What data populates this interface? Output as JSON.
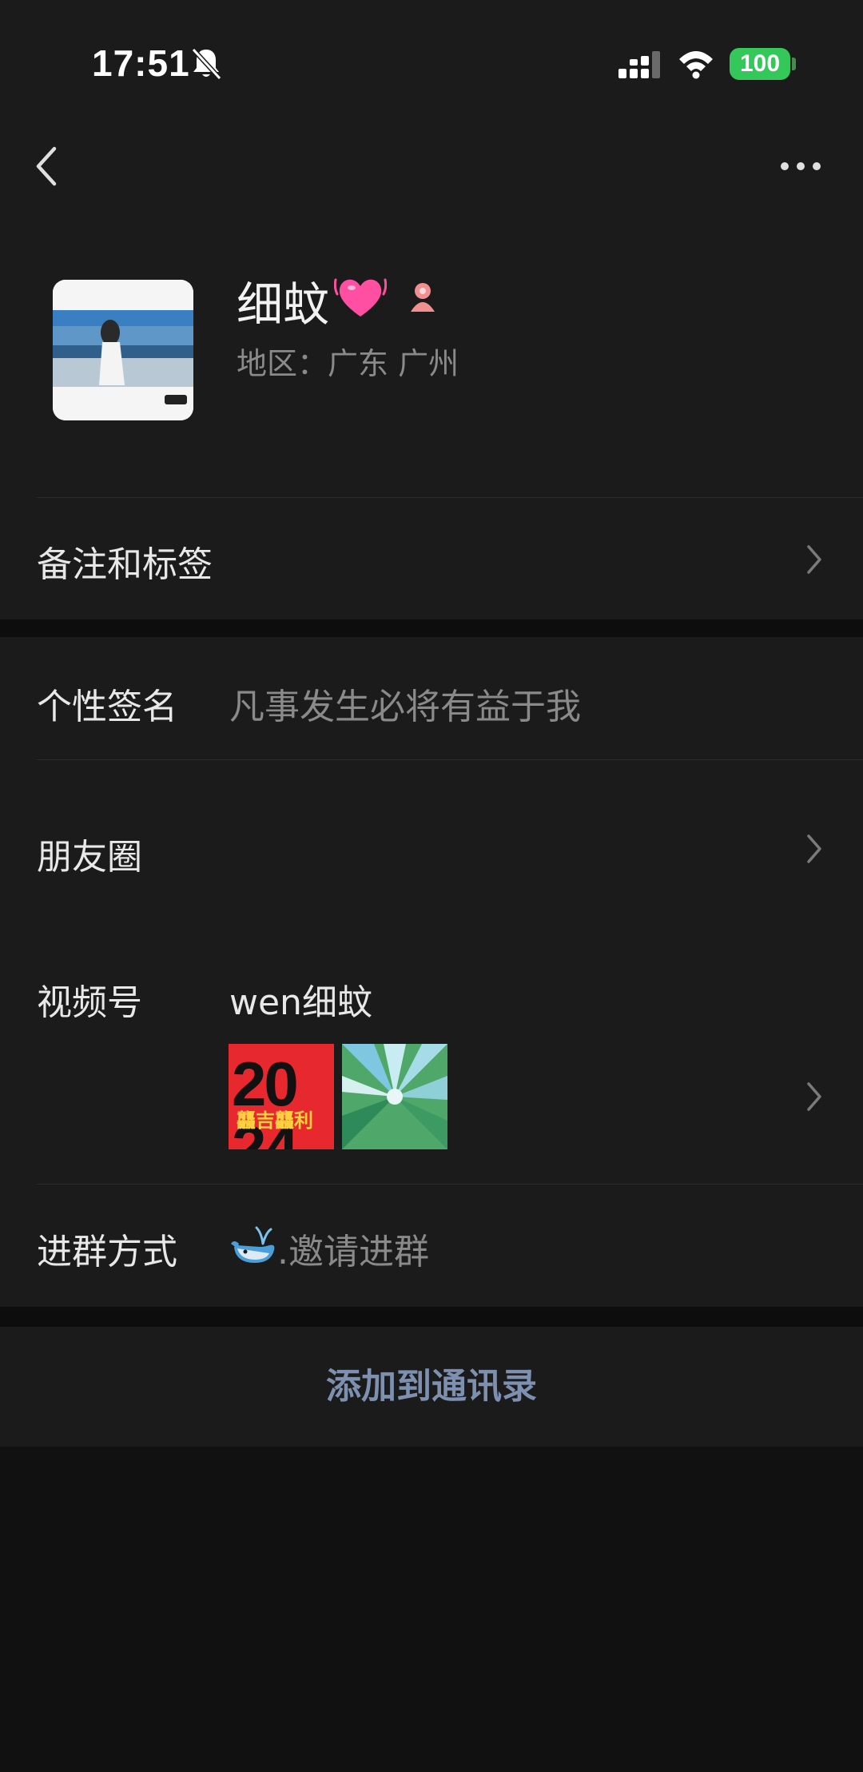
{
  "status_bar": {
    "time": "17:51",
    "battery": "100",
    "icons": [
      "bell-slash-icon",
      "cellular-signal-icon",
      "wifi-icon",
      "battery-icon"
    ]
  },
  "nav": {
    "icons": [
      "chevron-left-icon",
      "more-horizontal-icon"
    ]
  },
  "profile": {
    "name": "细蚊",
    "name_emoji_icon": "pink-heart-icon",
    "gender_icon": "female-icon",
    "region": "地区：广东 广州",
    "avatar_badge": "剪映"
  },
  "rows": {
    "remark": {
      "label": "备注和标签"
    },
    "signature": {
      "label": "个性签名",
      "value": "凡事发生必将有益于我"
    },
    "moments": {
      "label": "朋友圈"
    },
    "channels": {
      "label": "视频号",
      "value": "wen细蚊",
      "thumbnails": [
        {
          "text": "20\n24",
          "overlay": "龘吉龘利",
          "bg": "#e8282f"
        },
        {
          "overlay": "",
          "bg": "#5fb37a"
        }
      ]
    },
    "group_join": {
      "label": "进群方式",
      "icon": "whale-icon",
      "value": ".邀请进群"
    }
  },
  "actions": {
    "add_contact": "添加到通讯录"
  },
  "colors": {
    "background": "#1b1b1b",
    "page_bottom": "#111111",
    "secondary_text": "#8a8a8a",
    "link_blue": "#7e90b0",
    "battery_green": "#34c759"
  }
}
